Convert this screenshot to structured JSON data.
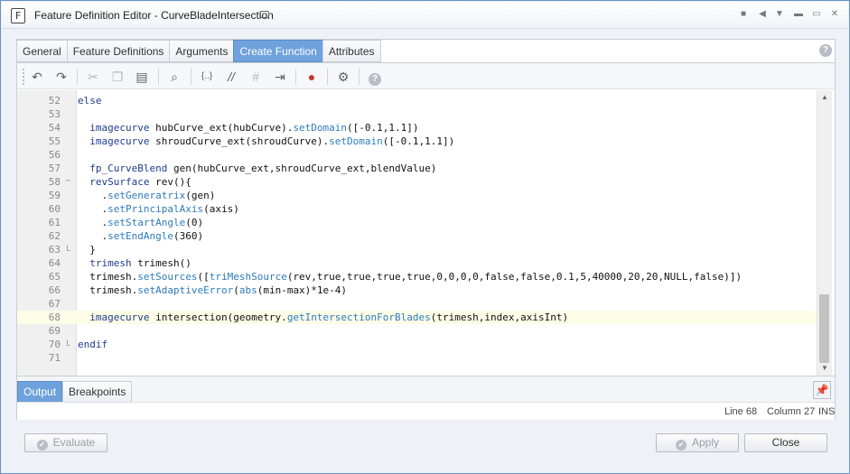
{
  "window": {
    "app_icon": "F",
    "title": "Feature Definition Editor - CurveBladeIntersection",
    "controls": [
      "stop-icon",
      "prev-icon",
      "next-icon",
      "minimize-icon",
      "maximize-icon",
      "close-icon"
    ]
  },
  "tabs": [
    {
      "label": "General",
      "active": false
    },
    {
      "label": "Feature Definitions",
      "active": false
    },
    {
      "label": "Arguments",
      "active": false
    },
    {
      "label": "Create Function",
      "active": true
    },
    {
      "label": "Attributes",
      "active": false
    }
  ],
  "toolbar": {
    "icons": [
      "undo-icon",
      "redo-icon",
      "cut-icon",
      "copy-icon",
      "paste-icon",
      "find-icon",
      "braces-icon",
      "comment-icon",
      "uncomment-icon",
      "indent-icon",
      "breakpoint-icon",
      "settings-icon",
      "help-icon"
    ]
  },
  "editor": {
    "current_line": 68,
    "lines": [
      {
        "num": "52",
        "fold": "",
        "tokens": [
          {
            "t": "else",
            "c": "kw"
          }
        ]
      },
      {
        "num": "53",
        "fold": "",
        "tokens": []
      },
      {
        "num": "54",
        "fold": "",
        "tokens": [
          {
            "t": "  imagecurve",
            "c": "kw"
          },
          {
            "t": " hubCurve_ext(hubCurve).",
            "c": ""
          },
          {
            "t": "setDomain",
            "c": "mt"
          },
          {
            "t": "([-0.1,1.1])",
            "c": ""
          }
        ]
      },
      {
        "num": "55",
        "fold": "",
        "tokens": [
          {
            "t": "  imagecurve",
            "c": "kw"
          },
          {
            "t": " shroudCurve_ext(shroudCurve).",
            "c": ""
          },
          {
            "t": "setDomain",
            "c": "mt"
          },
          {
            "t": "([-0.1,1.1])",
            "c": ""
          }
        ]
      },
      {
        "num": "56",
        "fold": "",
        "tokens": []
      },
      {
        "num": "57",
        "fold": "",
        "tokens": [
          {
            "t": "  fp_CurveBlend",
            "c": "kw"
          },
          {
            "t": " gen(hubCurve_ext,shroudCurve_ext,blendValue)",
            "c": ""
          }
        ]
      },
      {
        "num": "58",
        "fold": "⌐",
        "tokens": [
          {
            "t": "  revSurface",
            "c": "kw"
          },
          {
            "t": " rev(){",
            "c": ""
          }
        ]
      },
      {
        "num": "59",
        "fold": "",
        "tokens": [
          {
            "t": "    .",
            "c": ""
          },
          {
            "t": "setGeneratrix",
            "c": "mt"
          },
          {
            "t": "(gen)",
            "c": ""
          }
        ]
      },
      {
        "num": "60",
        "fold": "",
        "tokens": [
          {
            "t": "    .",
            "c": ""
          },
          {
            "t": "setPrincipalAxis",
            "c": "mt"
          },
          {
            "t": "(axis)",
            "c": ""
          }
        ]
      },
      {
        "num": "61",
        "fold": "",
        "tokens": [
          {
            "t": "    .",
            "c": ""
          },
          {
            "t": "setStartAngle",
            "c": "mt"
          },
          {
            "t": "(0)",
            "c": ""
          }
        ]
      },
      {
        "num": "62",
        "fold": "",
        "tokens": [
          {
            "t": "    .",
            "c": ""
          },
          {
            "t": "setEndAngle",
            "c": "mt"
          },
          {
            "t": "(360)",
            "c": ""
          }
        ]
      },
      {
        "num": "63",
        "fold": "L",
        "tokens": [
          {
            "t": "  }",
            "c": ""
          }
        ]
      },
      {
        "num": "64",
        "fold": "",
        "tokens": [
          {
            "t": "  trimesh",
            "c": "kw"
          },
          {
            "t": " trimesh()",
            "c": ""
          }
        ]
      },
      {
        "num": "65",
        "fold": "",
        "tokens": [
          {
            "t": "  trimesh.",
            "c": ""
          },
          {
            "t": "setSources",
            "c": "mt"
          },
          {
            "t": "([",
            "c": ""
          },
          {
            "t": "triMeshSource",
            "c": "mt"
          },
          {
            "t": "(rev,true,true,true,true,0,0,0,0,false,false,0.1,5,40000,20,20,NULL,false)])",
            "c": ""
          }
        ]
      },
      {
        "num": "66",
        "fold": "",
        "tokens": [
          {
            "t": "  trimesh.",
            "c": ""
          },
          {
            "t": "setAdaptiveError",
            "c": "mt"
          },
          {
            "t": "(",
            "c": ""
          },
          {
            "t": "abs",
            "c": "mt"
          },
          {
            "t": "(min-max)*1e-4)",
            "c": ""
          }
        ]
      },
      {
        "num": "67",
        "fold": "",
        "tokens": []
      },
      {
        "num": "68",
        "fold": "",
        "tokens": [
          {
            "t": "  imagecurve",
            "c": "kw"
          },
          {
            "t": " intersection(geometry.",
            "c": ""
          },
          {
            "t": "getIntersectionForBlades",
            "c": "mt"
          },
          {
            "t": "(trimesh,index,axisInt)",
            "c": ""
          }
        ]
      },
      {
        "num": "69",
        "fold": "",
        "tokens": []
      },
      {
        "num": "70",
        "fold": "L",
        "tokens": [
          {
            "t": "endif",
            "c": "kw"
          }
        ]
      },
      {
        "num": "71",
        "fold": "",
        "tokens": []
      }
    ]
  },
  "bottom_tabs": [
    {
      "label": "Output",
      "active": true
    },
    {
      "label": "Breakpoints",
      "active": false
    }
  ],
  "status": {
    "line": "Line 68",
    "column": "Column 27",
    "mode": "INS"
  },
  "buttons": {
    "evaluate": "Evaluate",
    "apply": "Apply",
    "close": "Close"
  },
  "colors": {
    "accent": "#6fa2dc",
    "keyword": "#1e3c8c",
    "method": "#2e7bbd",
    "current_line": "#fdfde8"
  }
}
